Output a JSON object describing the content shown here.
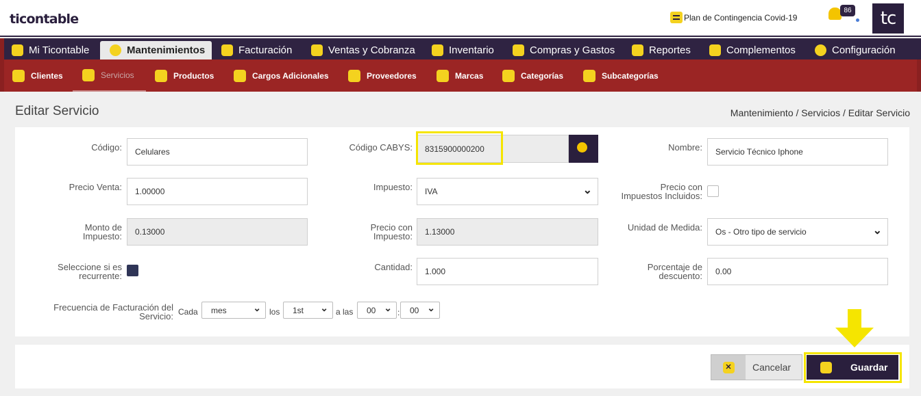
{
  "app": {
    "logo": "ticontable",
    "avatar": "tc"
  },
  "header": {
    "contingency_link": "Plan de Contingencia Covid-19",
    "notifications_count": "86"
  },
  "main_nav": {
    "tabs": [
      "Mi Ticontable",
      "Mantenimientos",
      "Facturación",
      "Ventas y Cobranza",
      "Inventario",
      "Compras y Gastos",
      "Reportes",
      "Complementos",
      "Configuración"
    ],
    "active": "Mantenimientos"
  },
  "sub_nav": {
    "tabs": [
      "Clientes",
      "Servicios",
      "Productos",
      "Cargos Adicionales",
      "Proveedores",
      "Marcas",
      "Categorías",
      "Subcategorías"
    ],
    "active": "Servicios"
  },
  "page": {
    "title": "Editar Servicio",
    "breadcrumb": "Mantenimiento / Servicios / Editar Servicio"
  },
  "form": {
    "codigo": {
      "label": "Código:",
      "value": "Celulares"
    },
    "cabys": {
      "label": "Código CABYS:",
      "value": "8315900000200"
    },
    "nombre": {
      "label": "Nombre:",
      "value": "Servicio Técnico Iphone"
    },
    "precio_venta": {
      "label": "Precio Venta:",
      "value": "1.00000"
    },
    "impuesto": {
      "label": "Impuesto:",
      "value": "IVA"
    },
    "precio_incluye": {
      "label_line1": "Precio con",
      "label_line2": "Impuestos Incluidos:",
      "checked": false
    },
    "monto_impuesto": {
      "label_line1": "Monto de",
      "label_line2": "Impuesto:",
      "value": "0.13000"
    },
    "precio_con_impuesto": {
      "label_line1": "Precio con",
      "label_line2": "Impuesto:",
      "value": "1.13000"
    },
    "unidad": {
      "label": "Unidad de Medida:",
      "value": "Os - Otro tipo de servicio"
    },
    "recurrente": {
      "label_line1": "Seleccione si es",
      "label_line2": "recurrente:",
      "checked": true
    },
    "cantidad": {
      "label": "Cantidad:",
      "value": "1.000"
    },
    "descuento": {
      "label_line1": "Porcentaje de",
      "label_line2": "descuento:",
      "value": "0.00"
    },
    "frecuencia": {
      "label_line1": "Frecuencia de Facturación del",
      "label_line2": "Servicio:",
      "cada": "Cada",
      "periodo": "mes",
      "los": "los",
      "dia": "1st",
      "a_las": "a las",
      "hora": "00",
      "sep": ":",
      "minuto": "00"
    }
  },
  "actions": {
    "cancel": "Cancelar",
    "save": "Guardar"
  },
  "colors": {
    "nav_dark": "#2f2342",
    "subnav_red": "#9b2524",
    "accent_yellow": "#f4d21f",
    "highlight": "#f5e500"
  }
}
